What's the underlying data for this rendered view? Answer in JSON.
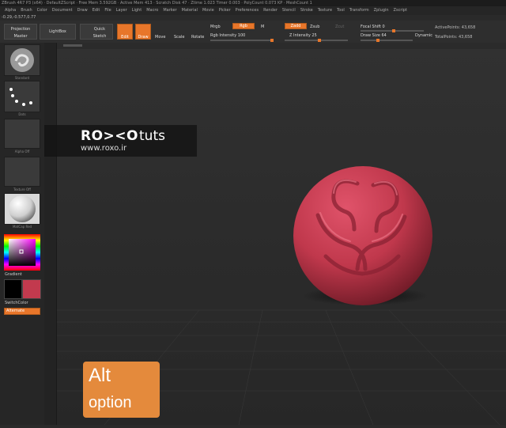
{
  "title_bar": "ZBrush 4R7 P3 (x64) · DefaultZScript · Free Mem 3.592GB · Active Mem 413 · Scratch Disk 47 · Ztime 1.023 Timer 0.003 · PolyCount 0.073 KP · MeshCount 1",
  "menu": [
    "Alpha",
    "Brush",
    "Color",
    "Document",
    "Draw",
    "Edit",
    "File",
    "Layer",
    "Light",
    "Macro",
    "Marker",
    "Material",
    "Movie",
    "Picker",
    "Preferences",
    "Render",
    "Stencil",
    "Stroke",
    "Texture",
    "Tool",
    "Transform",
    "Zplugin",
    "Zscript"
  ],
  "coords": "-0.29,-0.577,0.77",
  "shelf": {
    "projection_master": "Projection Master",
    "lightbox": "LightBox",
    "quick_sketch": "Quick Sketch",
    "edit": "Edit",
    "draw": "Draw",
    "move": "Move",
    "scale": "Scale",
    "rotate": "Rotate",
    "mrgb": "Mrgb",
    "rgb": "Rgb",
    "m": "M",
    "zadd": "Zadd",
    "zsub": "Zsub",
    "zcut": "Zcut",
    "rgb_intensity": "Rgb Intensity 100",
    "z_intensity": "Z Intensity 25",
    "focal_shift": "Focal Shift 0",
    "draw_size": "Draw Size 64",
    "dynamic": "Dynamic",
    "active_points": "ActivePoints: 43,658",
    "total_points": "TotalPoints: 43,658"
  },
  "left": {
    "brush_caption": "Standard",
    "stroke_caption": "Dots",
    "alpha_caption": "Alpha Off",
    "texture_caption": "Texture Off",
    "material_caption": "MatCap Red",
    "gradient": "Gradient",
    "switchcolor": "SwitchColor",
    "alternate": "Alternate"
  },
  "watermark": {
    "logo": "RO><O",
    "tuts": "tuts",
    "url": "www.roxo.ir"
  },
  "key_hint": {
    "line1": "Alt",
    "line2": "option"
  },
  "colors": {
    "accent": "#e8762a",
    "model": "#c23a4e",
    "hint_bg": "#e48a3c"
  }
}
